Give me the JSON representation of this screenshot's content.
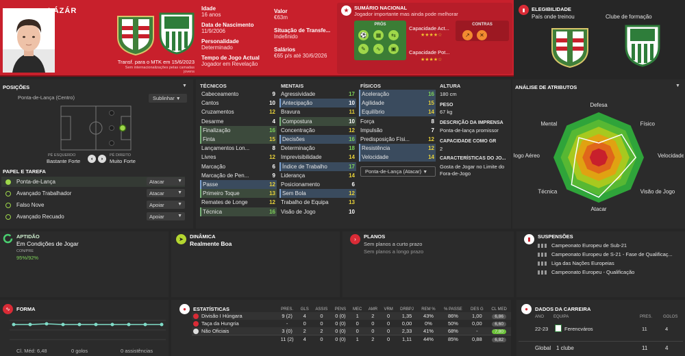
{
  "header": {
    "name": "LÁZÁR",
    "transfer_note": "Transf. para o MTK em 15/6/2023",
    "transfer_sub": "Sem internacionalizações pelas camadas jovens",
    "age_label": "Idade",
    "age": "16 anos",
    "dob_label": "Data de Nascimento",
    "dob": "11/9/2006",
    "personality_label": "Personalidade",
    "personality": "Determinado",
    "playtime_label": "Tempo de Jogo Actual",
    "playtime": "Jogador em Revelação",
    "value_label": "Valor",
    "value": "€63m",
    "transfer_status_label": "Situação de Transfe...",
    "transfer_status": "Indefinido",
    "wages_label": "Salários",
    "wages": "€65 p/s até 30/6/2026"
  },
  "summary": {
    "title": "SUMÁRIO NACIONAL",
    "subtitle": "Jogador importante mas ainda pode melhorar",
    "pros": "PRÓS",
    "cons": "CONTRAS",
    "cap_act_label": "Capacidade Act...",
    "cap_pot_label": "Capacidade Pot...",
    "cap_act_stars": "★★★★☆",
    "cap_pot_stars": "★★★★☆"
  },
  "eligibility": {
    "title": "ELEGIBILIDADE",
    "trained": "País onde treinou",
    "formation": "Clube de formação"
  },
  "positions": {
    "title": "POSIÇÕES",
    "primary": "Ponta-de-Lança (Centro)",
    "button": "Sublinhar",
    "left_foot_label": "PÉ ESQUERDO",
    "left_foot": "Bastante Forte",
    "right_foot_label": "PÉ DIREITO",
    "right_foot": "Muito Forte"
  },
  "roles": {
    "title": "PAPEL E TAREFA",
    "items": [
      {
        "name": "Ponta-de-Lança",
        "duty": "Atacar"
      },
      {
        "name": "Avançado Trabalhador",
        "duty": "Atacar"
      },
      {
        "name": "Falso Nove",
        "duty": "Apoiar"
      },
      {
        "name": "Avançado Recuado",
        "duty": "Apoiar"
      }
    ]
  },
  "technical": {
    "title": "TÉCNICOS",
    "items": [
      {
        "l": "Cabeceamento",
        "v": "9"
      },
      {
        "l": "Cantos",
        "v": "10"
      },
      {
        "l": "Cruzamentos",
        "v": "12"
      },
      {
        "l": "Desarme",
        "v": "4"
      },
      {
        "l": "Finalização",
        "v": "16"
      },
      {
        "l": "Finta",
        "v": "15"
      },
      {
        "l": "Lançamentos Lon...",
        "v": "8"
      },
      {
        "l": "Livres",
        "v": "12"
      },
      {
        "l": "Marcação",
        "v": "6"
      },
      {
        "l": "Marcação de Pen...",
        "v": "9"
      },
      {
        "l": "Passe",
        "v": "12"
      },
      {
        "l": "Primeiro Toque",
        "v": "13"
      },
      {
        "l": "Remates de Longe",
        "v": "12"
      },
      {
        "l": "Técnica",
        "v": "16"
      }
    ]
  },
  "mental": {
    "title": "MENTAIS",
    "items": [
      {
        "l": "Agressividade",
        "v": "17"
      },
      {
        "l": "Antecipação",
        "v": "10"
      },
      {
        "l": "Bravura",
        "v": "11"
      },
      {
        "l": "Compostura",
        "v": "10"
      },
      {
        "l": "Concentração",
        "v": "12"
      },
      {
        "l": "Decisões",
        "v": "16"
      },
      {
        "l": "Determinação",
        "v": "18"
      },
      {
        "l": "Imprevisibilidade",
        "v": "14"
      },
      {
        "l": "Índice de Trabalho",
        "v": "17"
      },
      {
        "l": "Liderança",
        "v": "14"
      },
      {
        "l": "Posicionamento",
        "v": "6"
      },
      {
        "l": "Sem Bola",
        "v": "12"
      },
      {
        "l": "Trabalho de Equipa",
        "v": "13"
      },
      {
        "l": "Visão de Jogo",
        "v": "10"
      }
    ]
  },
  "physical": {
    "title": "FÍSICOS",
    "items": [
      {
        "l": "Aceleração",
        "v": "16"
      },
      {
        "l": "Agilidade",
        "v": "15"
      },
      {
        "l": "Equilíbrio",
        "v": "14"
      },
      {
        "l": "Força",
        "v": "8"
      },
      {
        "l": "Impulsão",
        "v": "7"
      },
      {
        "l": "Predisposição Físi...",
        "v": "12"
      },
      {
        "l": "Resistência",
        "v": "12"
      },
      {
        "l": "Velocidade",
        "v": "14"
      }
    ],
    "role_select": "Ponta-de-Lança (Atacar)"
  },
  "info": {
    "height_label": "ALTURA",
    "height": "180 cm",
    "weight_label": "PESO",
    "weight": "67 kg",
    "press_label": "DESCRIÇÃO DA IMPRENSA",
    "press": "Ponta-de-lança promissor",
    "gk_label": "CAPACIDADE COMO GR",
    "gk": "2",
    "traits_label": "CARACTERÍSTICAS DO JO...",
    "trait": "Gosta de Jogar no Limite do Fora-de-Jogo"
  },
  "analysis": {
    "title": "ANÁLISE DE ATRIBUTOS",
    "labels": [
      "Defesa",
      "Físico",
      "Velocidade",
      "Visão de Jogo",
      "Atacar",
      "Técnica",
      "Jogo Aéreo",
      "Mental"
    ],
    "values": [
      0.32,
      0.72,
      0.82,
      0.62,
      0.88,
      0.85,
      0.52,
      0.62
    ]
  },
  "aptitude": {
    "title": "APTIDÃO",
    "value": "Em Condições de Jogar",
    "sub_label": "CON/PRE",
    "sub": "95%/92%"
  },
  "dynamics": {
    "title": "DINÂMICA",
    "value": "Realmente Boa"
  },
  "plans": {
    "title": "PLANOS",
    "line1": "Sem planos a curto prazo",
    "line2": "Sem planos a longo prazo"
  },
  "suspensions": {
    "title": "SUSPENSÕES",
    "items": [
      "Campeonato Europeu de Sub-21",
      "Campeonato Europeu de S-21 - Fase de Qualificaç...",
      "Liga das Nações Europeias",
      "Campeonato Europeu - Qualificação"
    ]
  },
  "form": {
    "title": "FORMA",
    "avg": "Cl. Méd: 6,48",
    "goals": "0 golos",
    "assists": "0 assistências"
  },
  "stats": {
    "title": "ESTATÍSTICAS",
    "headers": [
      "PRES.",
      "GLS",
      "ASSIS",
      "PENS",
      "MEC",
      "AMR",
      "VRM",
      "DRBPJ",
      "REM %",
      "% PASSE",
      "DES G",
      "CL MED"
    ],
    "rows": [
      {
        "comp": "Divisão I Húngara",
        "vals": [
          "9 (2)",
          "4",
          "0",
          "0 (0)",
          "1",
          "2",
          "0",
          "1,35",
          "43%",
          "86%",
          "1,00",
          "6,86"
        ]
      },
      {
        "comp": "Taça da Hungria",
        "vals": [
          "-",
          "0",
          "0",
          "0 (0)",
          "0",
          "0",
          "0",
          "0,00",
          "0%",
          "50%",
          "0,00",
          "6,60"
        ]
      },
      {
        "comp": "Não Oficiais",
        "vals": [
          "3 (0)",
          "2",
          "2",
          "0 (0)",
          "0",
          "0",
          "0",
          "2,33",
          "41%",
          "68%",
          "-",
          "7,80"
        ]
      }
    ],
    "total": [
      "11 (2)",
      "4",
      "0",
      "0 (0)",
      "1",
      "2",
      "0",
      "1,11",
      "44%",
      "85%",
      "0,88",
      "6,82"
    ]
  },
  "career": {
    "title": "DADOS DA CARREIRA",
    "h_year": "ANO",
    "h_team": "EQUIPA",
    "h_apps": "PRES.",
    "h_goals": "GOLOS",
    "year": "22-23",
    "team": "Ferencváros",
    "apps": "11",
    "goals": "4",
    "global_label": "Global",
    "global_team": "1 clube",
    "global_apps": "11",
    "global_goals": "4"
  }
}
